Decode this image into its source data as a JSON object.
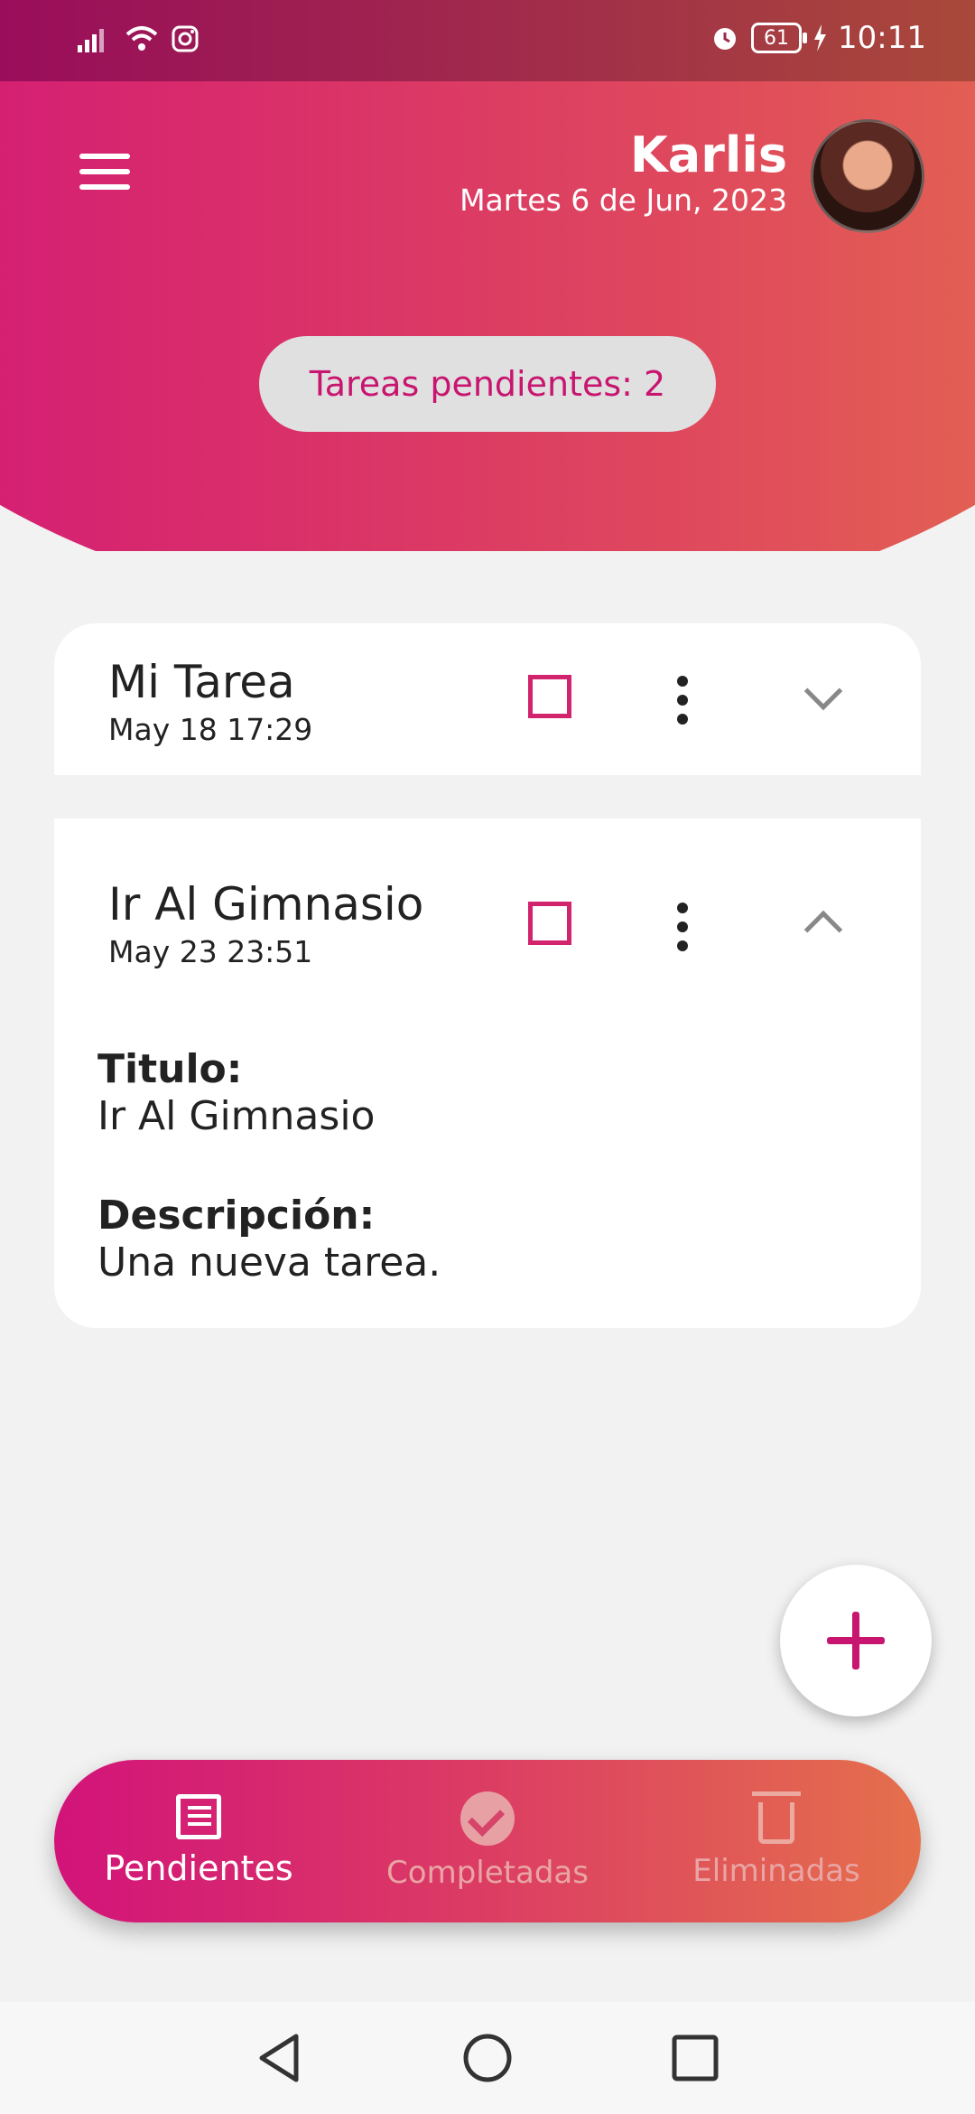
{
  "status_bar": {
    "time": "10:11",
    "battery": "61",
    "icons": [
      "signal-icon",
      "wifi-icon",
      "instagram-icon",
      "alarm-icon",
      "battery-icon",
      "charging-icon"
    ]
  },
  "header": {
    "user_name": "Karlis",
    "date": "Martes 6 de Jun, 2023",
    "pending_label": "Tareas pendientes: 2"
  },
  "tasks": [
    {
      "title": "Mi Tarea",
      "date": "May 18 17:29",
      "expanded": false
    },
    {
      "title": "Ir Al Gimnasio",
      "date": "May 23 23:51",
      "expanded": true,
      "details": {
        "title_label": "Titulo:",
        "title_value": "Ir Al Gimnasio",
        "description_label": "Descripción:",
        "description_value": "Una nueva tarea."
      }
    }
  ],
  "bottom_nav": {
    "items": [
      {
        "label": "Pendientes",
        "icon": "list-icon",
        "active": true
      },
      {
        "label": "Completadas",
        "icon": "check-circle-icon",
        "active": false
      },
      {
        "label": "Eliminadas",
        "icon": "trash-icon",
        "active": false
      }
    ]
  },
  "colors": {
    "accent": "#c8156f",
    "gradient_start": "#d2137a",
    "gradient_end": "#e8744a",
    "background": "#f2f2f2"
  }
}
